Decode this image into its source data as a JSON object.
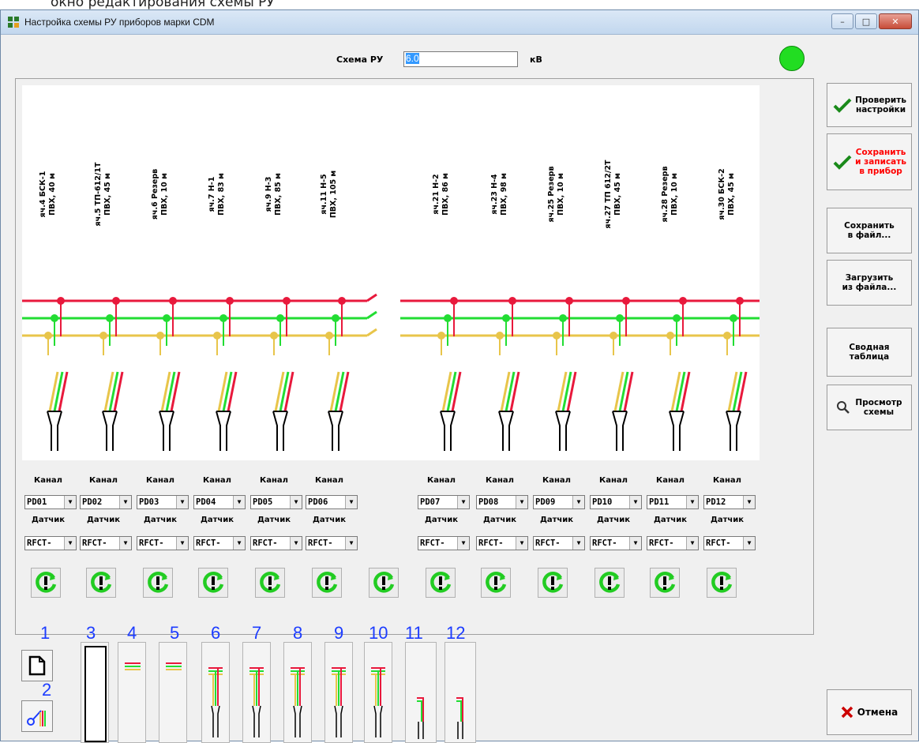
{
  "caption": "окно редактирования схемы РУ",
  "window": {
    "title": "Настройка схемы РУ приборов марки CDM",
    "minimize": "–",
    "maximize": "□",
    "close": "✕"
  },
  "scheme": {
    "label": "Схема РУ",
    "value": "6.0",
    "unit": "кВ",
    "status_color": "#22dd22"
  },
  "feeders_left": [
    {
      "label": "яч.4 БСК-1\nПВХ, 40 м",
      "channel": "PD01",
      "sensor": "RFCT-"
    },
    {
      "label": "яч.5 ТП-612/1Т\nПВХ, 45 м",
      "channel": "PD02",
      "sensor": "RFCT-"
    },
    {
      "label": "яч.6 Резерв\nПВХ, 10 м",
      "channel": "PD03",
      "sensor": "RFCT-"
    },
    {
      "label": "яч.7 Н-1\nПВХ, 83 м",
      "channel": "PD04",
      "sensor": "RFCT-"
    },
    {
      "label": "яч.9 Н-3\nПВХ, 85 м",
      "channel": "PD05",
      "sensor": "RFCT-"
    },
    {
      "label": "яч.11 Н-5\nПВХ, 105 м",
      "channel": "PD06",
      "sensor": "RFCT-"
    }
  ],
  "feeders_right": [
    {
      "label": "яч.21 Н-2\nПВХ, 86 м",
      "channel": "PD07",
      "sensor": "RFCT-"
    },
    {
      "label": "яч.23 Н-4\nПВХ, 98 м",
      "channel": "PD08",
      "sensor": "RFCT-"
    },
    {
      "label": "яч.25 Резерв\nПВХ, 10 м",
      "channel": "PD09",
      "sensor": "RFCT-"
    },
    {
      "label": "яч.27 ТП 612/2Т\nПВХ, 45 м",
      "channel": "PD10",
      "sensor": "RFCT-"
    },
    {
      "label": "яч.28 Резерв\nПВХ, 10 м",
      "channel": "PD11",
      "sensor": "RFCT-"
    },
    {
      "label": "яч.30 БСК-2\nПВХ, 45 м",
      "channel": "PD12",
      "sensor": "RFCT-"
    }
  ],
  "channel_label": "Канал",
  "sensor_label": "Датчик",
  "side_buttons": {
    "check": "Проверить\nнастройки",
    "save_write": "Сохранить\nи записать\nв прибор",
    "save_file": "Сохранить\nв файл...",
    "load_file": "Загрузить\nиз файла...",
    "summary": "Сводная\nтаблица",
    "view": "Просмотр\nсхемы",
    "cancel": "Отмена"
  },
  "tool_numbers": [
    "1",
    "2",
    "3",
    "4",
    "5",
    "6",
    "7",
    "8",
    "9",
    "10",
    "11",
    "12"
  ],
  "colors": {
    "red": "#e8193c",
    "green": "#22dd33",
    "yellow": "#e8c54a",
    "accent_text": "#ff0000",
    "check": "#1a8a1a"
  }
}
